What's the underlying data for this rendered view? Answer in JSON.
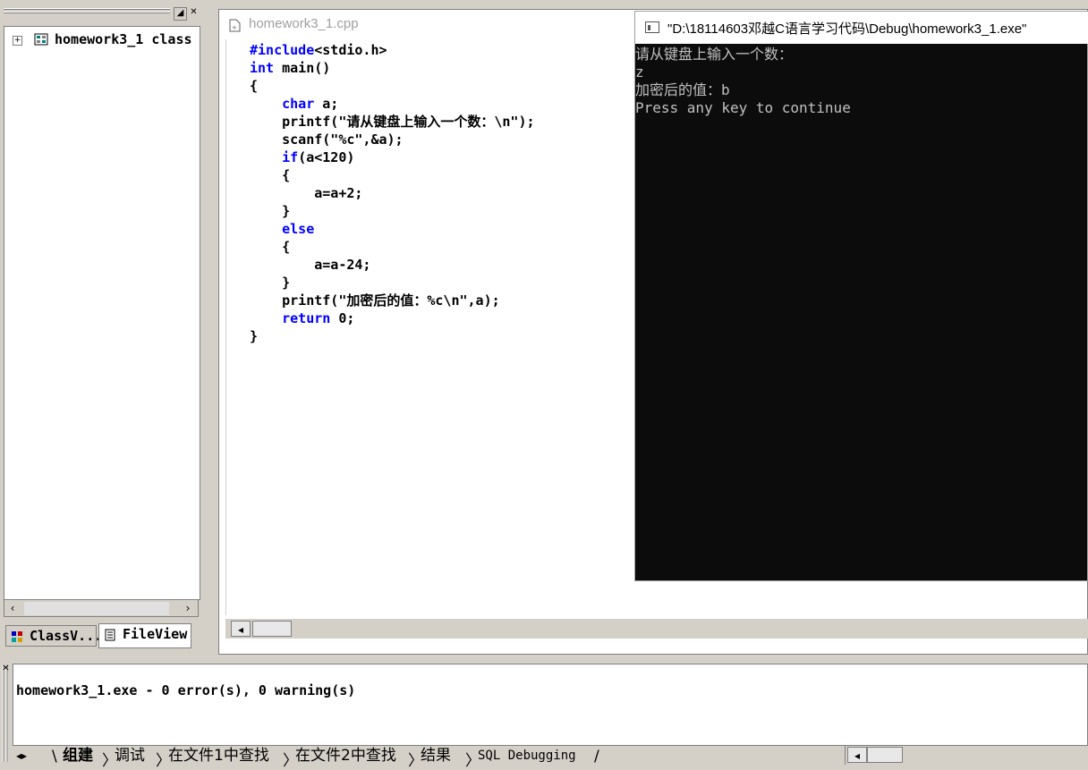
{
  "workspace": {
    "tree_root_label": "homework3_1 class",
    "tabs": [
      {
        "label": "ClassV...",
        "icon": "class-view-icon"
      },
      {
        "label": "FileView",
        "icon": "file-view-icon"
      }
    ]
  },
  "editor": {
    "file_title": "homework3_1.cpp",
    "code_lines": [
      [
        {
          "t": "#include",
          "k": 1
        },
        {
          "t": "<stdio.h>",
          "k": 0
        }
      ],
      [
        {
          "t": "int",
          "k": 1
        },
        {
          "t": " main()",
          "k": 0
        }
      ],
      [
        {
          "t": "{",
          "k": 0
        }
      ],
      [
        {
          "t": "    ",
          "k": 0
        },
        {
          "t": "char",
          "k": 1
        },
        {
          "t": " a;",
          "k": 0
        }
      ],
      [
        {
          "t": "    printf(\"请从键盘上输入一个数：\\n\");",
          "k": 0
        }
      ],
      [
        {
          "t": "    scanf(\"%c\",&a);",
          "k": 0
        }
      ],
      [
        {
          "t": "    ",
          "k": 0
        },
        {
          "t": "if",
          "k": 1
        },
        {
          "t": "(a<120)",
          "k": 0
        }
      ],
      [
        {
          "t": "    {",
          "k": 0
        }
      ],
      [
        {
          "t": "        a=a+2;",
          "k": 0
        }
      ],
      [
        {
          "t": "    }",
          "k": 0
        }
      ],
      [
        {
          "t": "    ",
          "k": 0
        },
        {
          "t": "else",
          "k": 1
        }
      ],
      [
        {
          "t": "    {",
          "k": 0
        }
      ],
      [
        {
          "t": "        a=a-24;",
          "k": 0
        }
      ],
      [
        {
          "t": "    }",
          "k": 0
        }
      ],
      [
        {
          "t": "    printf(\"加密后的值：%c\\n\",a);",
          "k": 0
        }
      ],
      [
        {
          "t": "    ",
          "k": 0
        },
        {
          "t": "return",
          "k": 1
        },
        {
          "t": " 0;",
          "k": 0
        }
      ],
      [
        {
          "t": "}",
          "k": 0
        }
      ]
    ]
  },
  "console": {
    "title": "\"D:\\18114603邓越C语言学习代码\\Debug\\homework3_1.exe\"",
    "lines": [
      "请从键盘上输入一个数：",
      "z",
      "加密后的值：b",
      "Press any key to continue"
    ]
  },
  "output": {
    "message": "homework3_1.exe - 0 error(s), 0 warning(s)",
    "tabs": [
      {
        "label": "组建",
        "active": true,
        "mono": false
      },
      {
        "label": "调试",
        "active": false,
        "mono": false
      },
      {
        "label": "在文件1中查找",
        "active": false,
        "mono": false
      },
      {
        "label": "在文件2中查找",
        "active": false,
        "mono": false
      },
      {
        "label": "结果",
        "active": false,
        "mono": false
      },
      {
        "label": "SQL Debugging",
        "active": false,
        "mono": true
      }
    ]
  },
  "colors": {
    "keyword": "#0000ff",
    "console_bg": "#0c0c0c",
    "console_text": "#c0c0c0"
  }
}
